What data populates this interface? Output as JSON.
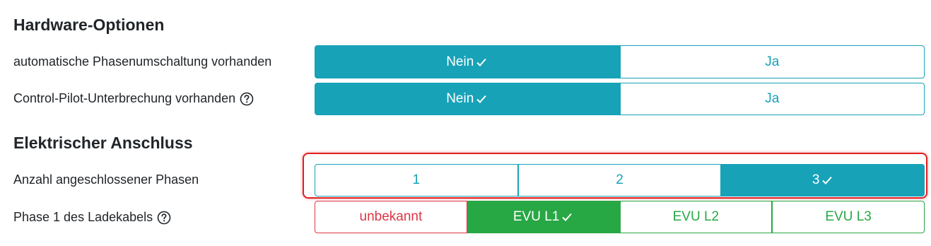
{
  "sections": {
    "hardware": {
      "title": "Hardware-Optionen",
      "rows": [
        {
          "label": "automatische Phasenumschaltung vorhanden",
          "has_help": false,
          "options": [
            {
              "label": "Nein",
              "selected": true
            },
            {
              "label": "Ja",
              "selected": false
            }
          ]
        },
        {
          "label": "Control-Pilot-Unterbrechung vorhanden",
          "has_help": true,
          "options": [
            {
              "label": "Nein",
              "selected": true
            },
            {
              "label": "Ja",
              "selected": false
            }
          ]
        }
      ]
    },
    "electrical": {
      "title": "Elektrischer Anschluss",
      "rows": [
        {
          "label": "Anzahl angeschlossener Phasen",
          "has_help": false,
          "options": [
            {
              "label": "1",
              "selected": false
            },
            {
              "label": "2",
              "selected": false
            },
            {
              "label": "3",
              "selected": true
            }
          ]
        },
        {
          "label": "Phase 1 des Ladekabels",
          "has_help": true,
          "options": [
            {
              "label": "unbekannt",
              "selected": false
            },
            {
              "label": "EVU L1",
              "selected": true
            },
            {
              "label": "EVU L2",
              "selected": false
            },
            {
              "label": "EVU L3",
              "selected": false
            }
          ]
        }
      ]
    }
  },
  "icons": {
    "help": "question-circle-icon",
    "check": "check-icon"
  },
  "colors": {
    "info": "#17a2b8",
    "success": "#28a745",
    "danger": "#dc3545",
    "highlight": "#e02020"
  }
}
